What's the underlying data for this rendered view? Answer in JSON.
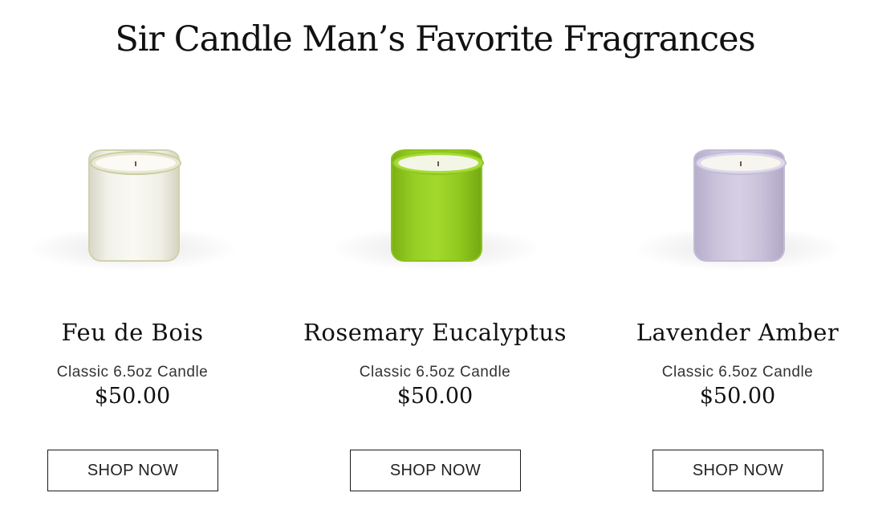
{
  "page": {
    "title": "Sir Candle Man’s Favorite Fragrances"
  },
  "products": [
    {
      "name": "Feu de Bois",
      "variant": "Classic 6.5oz Candle",
      "price": "$50.00",
      "button_label": "SHOP NOW",
      "image_color": "#f2f1e9"
    },
    {
      "name": "Rosemary Eucalyptus",
      "variant": "Classic 6.5oz Candle",
      "price": "$50.00",
      "button_label": "SHOP NOW",
      "image_color": "#98cf25"
    },
    {
      "name": "Lavender Amber",
      "variant": "Classic 6.5oz Candle",
      "price": "$50.00",
      "button_label": "SHOP NOW",
      "image_color": "#cbc4dc"
    }
  ]
}
